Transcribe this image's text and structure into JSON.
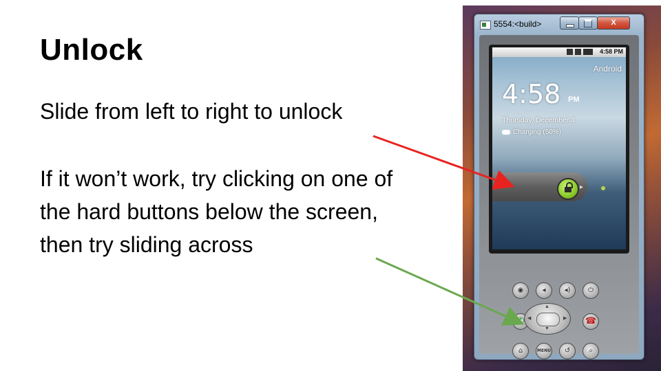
{
  "slide": {
    "title": "Unlock",
    "instruction": "Slide from left to right to unlock",
    "troubleshoot": "If it won’t work, try clicking on one of the hard buttons below the screen, then try sliding across"
  },
  "emulator": {
    "window_title": "5554:<build>",
    "close_label": "X",
    "screen": {
      "status_time": "4:58 PM",
      "carrier": "Android",
      "clock": "4:58",
      "ampm": "PM",
      "date": "Thursday, December 4",
      "charging": "Charging (50%)"
    },
    "buttons": {
      "menu_label": "MENU"
    }
  },
  "colors": {
    "arrow_red": "#e8231f",
    "arrow_green": "#6aa84f",
    "lock_green": "#8fcf2c"
  },
  "icons": [
    "camera-icon",
    "volume-down-icon",
    "volume-up-icon",
    "power-icon",
    "call-icon",
    "end-call-icon",
    "home-icon",
    "back-icon",
    "search-icon",
    "unlock-icon"
  ]
}
